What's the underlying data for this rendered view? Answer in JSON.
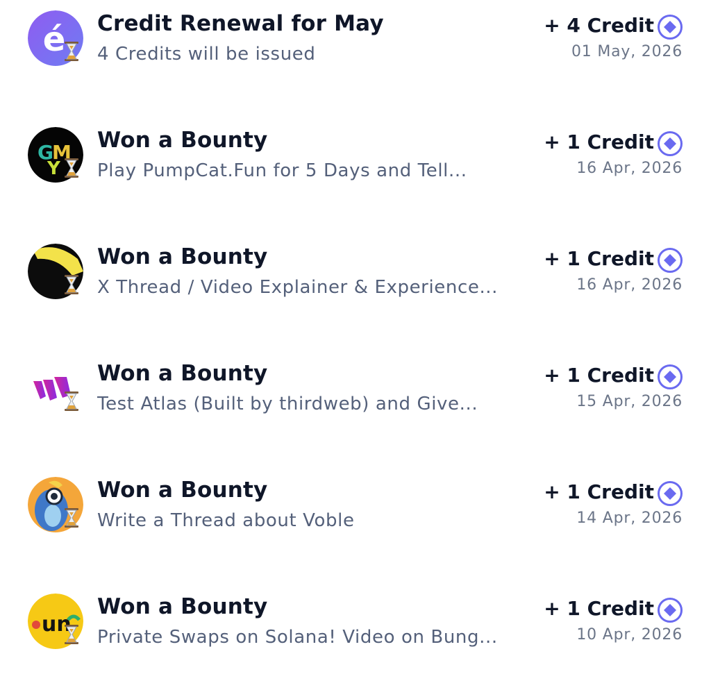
{
  "colors": {
    "title": "#0f1628",
    "subtitle": "#54607a",
    "date": "#6b7588",
    "credit_accent": "#6a6af0"
  },
  "transactions": [
    {
      "icon": "credit-logo-icon",
      "title": "Credit Renewal for May",
      "subtitle": "4 Credits will be issued",
      "amount": "+ 4 Credit",
      "date": "01 May, 2026",
      "status_icon": "hourglass-icon"
    },
    {
      "icon": "gmy-logo-icon",
      "title": "Won a Bounty",
      "subtitle": "Play PumpCat.Fun for 5 Days and Tell...",
      "amount": "+ 1 Credit",
      "date": "16 Apr, 2026",
      "status_icon": "hourglass-icon"
    },
    {
      "icon": "yellow-swoosh-logo-icon",
      "title": "Won a Bounty",
      "subtitle": "X Thread / Video Explainer & Experience...",
      "amount": "+ 1 Credit",
      "date": "16 Apr, 2026",
      "status_icon": "hourglass-icon"
    },
    {
      "icon": "atlas-logo-icon",
      "title": "Won a Bounty",
      "subtitle": "Test Atlas (Built by thirdweb) and Give...",
      "amount": "+ 1 Credit",
      "date": "15 Apr, 2026",
      "status_icon": "hourglass-icon"
    },
    {
      "icon": "voble-bird-logo-icon",
      "title": "Won a Bounty",
      "subtitle": "Write a Thread about Voble",
      "amount": "+ 1 Credit",
      "date": "14 Apr, 2026",
      "status_icon": "hourglass-icon"
    },
    {
      "icon": "unc-logo-icon",
      "title": "Won a Bounty",
      "subtitle": "Private Swaps on Solana! Video on Bung...",
      "amount": "+ 1 Credit",
      "date": "10 Apr, 2026",
      "status_icon": "hourglass-icon"
    }
  ],
  "logo_text": {
    "credit": "é",
    "gmy": [
      "G",
      "M",
      "Y"
    ],
    "unc": "un"
  }
}
